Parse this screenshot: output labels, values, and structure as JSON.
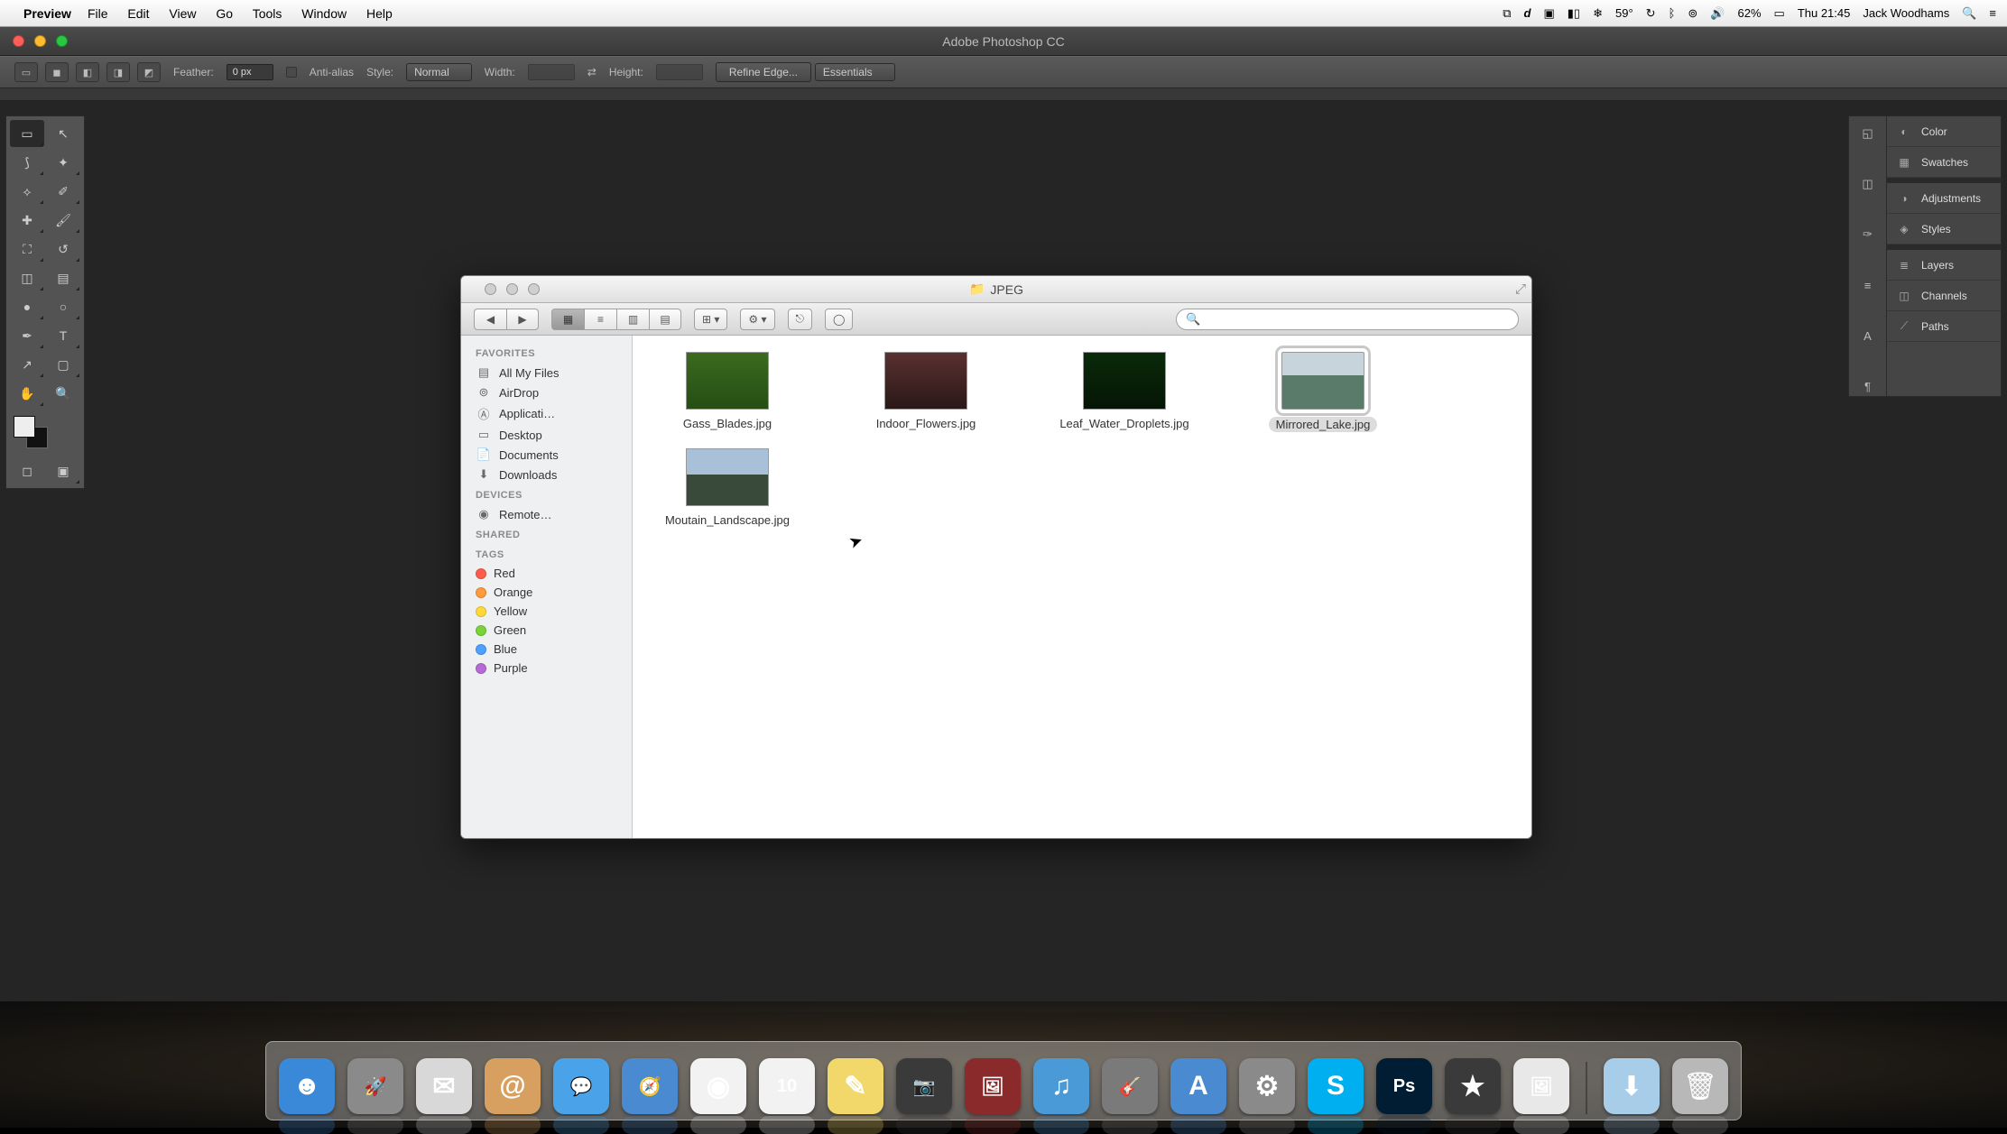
{
  "menubar": {
    "app": "Preview",
    "menus": [
      "File",
      "Edit",
      "View",
      "Go",
      "Tools",
      "Window",
      "Help"
    ],
    "status": {
      "temp": "59°",
      "battery": "62%",
      "clock": "Thu 21:45",
      "user": "Jack Woodhams"
    }
  },
  "photoshop": {
    "title": "Adobe Photoshop CC",
    "options": {
      "feather_label": "Feather:",
      "feather_value": "0 px",
      "antialias": "Anti-alias",
      "style_label": "Style:",
      "style_value": "Normal",
      "width": "Width:",
      "height": "Height:",
      "refine": "Refine Edge...",
      "workspace": "Essentials"
    },
    "panels": [
      "Color",
      "Swatches",
      "Adjustments",
      "Styles",
      "Layers",
      "Channels",
      "Paths"
    ]
  },
  "finder": {
    "title": "JPEG",
    "sidebar": {
      "favorites_head": "FAVORITES",
      "favorites": [
        "All My Files",
        "AirDrop",
        "Applicati…",
        "Desktop",
        "Documents",
        "Downloads"
      ],
      "devices_head": "DEVICES",
      "devices": [
        "Remote…"
      ],
      "shared_head": "SHARED",
      "tags_head": "TAGS",
      "tags": [
        {
          "name": "Red",
          "color": "#ff5c4d"
        },
        {
          "name": "Orange",
          "color": "#ff9b3a"
        },
        {
          "name": "Yellow",
          "color": "#ffd93a"
        },
        {
          "name": "Green",
          "color": "#7ad33a"
        },
        {
          "name": "Blue",
          "color": "#4da0ff"
        },
        {
          "name": "Purple",
          "color": "#b56bd6"
        }
      ]
    },
    "files": [
      {
        "name": "Gass_Blades.jpg",
        "thumb": "grass",
        "selected": false
      },
      {
        "name": "Indoor_Flowers.jpg",
        "thumb": "flowers",
        "selected": false
      },
      {
        "name": "Leaf_Water_Droplets.jpg",
        "thumb": "leaf",
        "selected": false
      },
      {
        "name": "Mirrored_Lake.jpg",
        "thumb": "lake",
        "selected": true
      },
      {
        "name": "Moutain_Landscape.jpg",
        "thumb": "mount",
        "selected": false
      }
    ]
  },
  "dock": {
    "apps": [
      {
        "name": "Finder",
        "color": "#3a89d8",
        "glyph": "☻"
      },
      {
        "name": "Launchpad",
        "color": "#8a8a8a",
        "glyph": "🚀"
      },
      {
        "name": "Mail",
        "color": "#d8d8d8",
        "glyph": "✉"
      },
      {
        "name": "Contacts",
        "color": "#d8a060",
        "glyph": "@"
      },
      {
        "name": "Messages",
        "color": "#4aa3e8",
        "glyph": "💬"
      },
      {
        "name": "Safari",
        "color": "#4a8ad0",
        "glyph": "🧭"
      },
      {
        "name": "Chrome",
        "color": "#f2f2f2",
        "glyph": "◉"
      },
      {
        "name": "Calendar",
        "color": "#f2f2f2",
        "glyph": "10"
      },
      {
        "name": "Notes",
        "color": "#f2d76a",
        "glyph": "✎"
      },
      {
        "name": "FaceTime",
        "color": "#3a3a3a",
        "glyph": "📷"
      },
      {
        "name": "iPhoto",
        "color": "#8a2a2a",
        "glyph": "🖼"
      },
      {
        "name": "iTunes",
        "color": "#4a9ad8",
        "glyph": "♫"
      },
      {
        "name": "GarageBand",
        "color": "#7a7a7a",
        "glyph": "🎸"
      },
      {
        "name": "AppStore",
        "color": "#4a8ad0",
        "glyph": "A"
      },
      {
        "name": "Settings",
        "color": "#8a8a8a",
        "glyph": "⚙"
      },
      {
        "name": "Skype",
        "color": "#00aff0",
        "glyph": "S"
      },
      {
        "name": "Photoshop",
        "color": "#001d34",
        "glyph": "Ps"
      },
      {
        "name": "iMovie",
        "color": "#3a3a3a",
        "glyph": "★"
      },
      {
        "name": "Preview",
        "color": "#e8e8e8",
        "glyph": "🖼"
      }
    ],
    "right": [
      {
        "name": "Downloads",
        "color": "#a8cde8",
        "glyph": "⬇"
      },
      {
        "name": "Trash",
        "color": "#b8b8b8",
        "glyph": "🗑"
      }
    ]
  }
}
